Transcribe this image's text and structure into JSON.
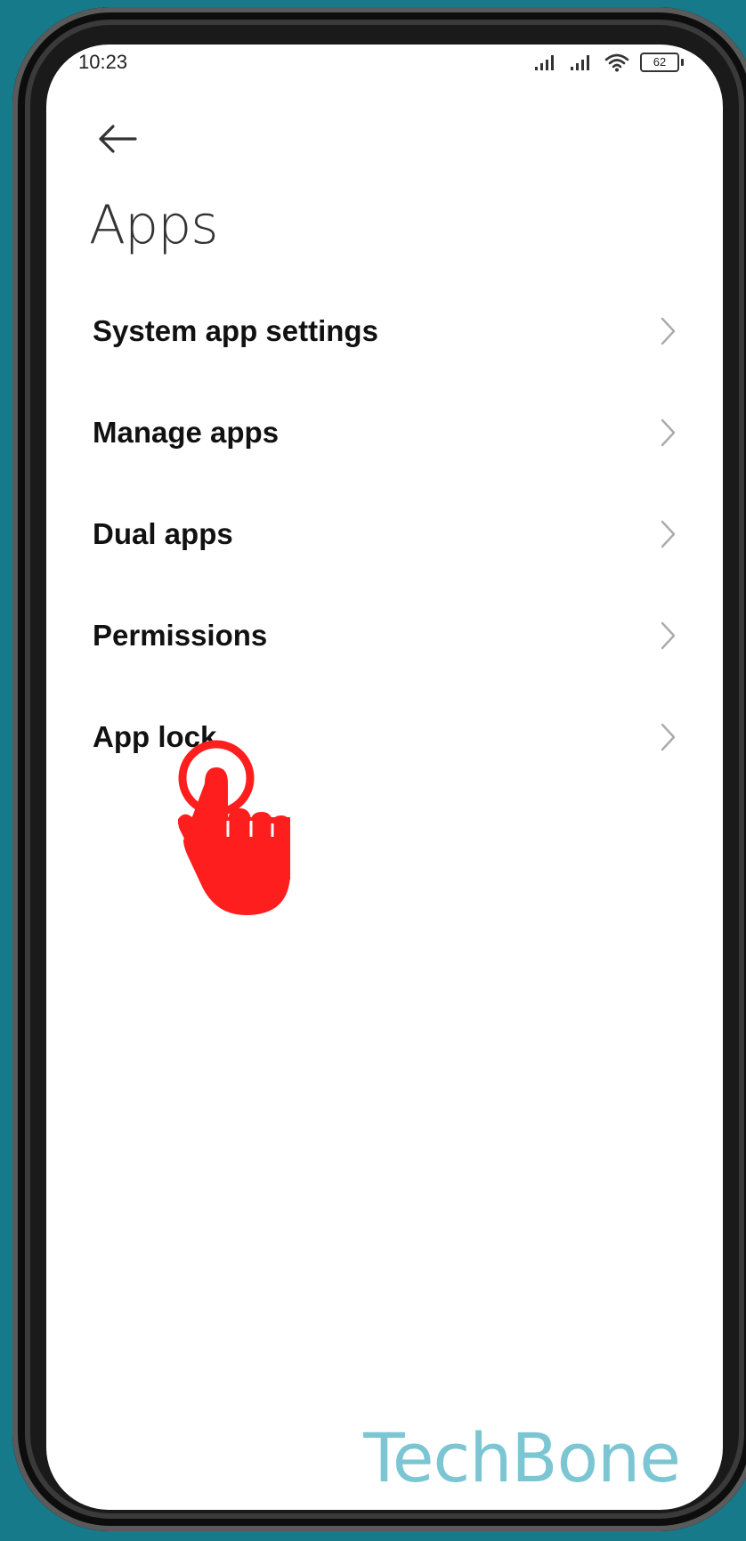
{
  "status_bar": {
    "time": "10:23",
    "battery": "62",
    "icons": [
      "signal-icon",
      "signal-icon",
      "wifi-icon",
      "battery-icon"
    ]
  },
  "header": {
    "back_icon": "back-arrow-icon",
    "title": "Apps"
  },
  "menu": {
    "items": [
      {
        "label": "System app settings",
        "icon": "chevron-right-icon"
      },
      {
        "label": "Manage apps",
        "icon": "chevron-right-icon"
      },
      {
        "label": "Dual apps",
        "icon": "chevron-right-icon"
      },
      {
        "label": "Permissions",
        "icon": "chevron-right-icon"
      },
      {
        "label": "App lock",
        "icon": "chevron-right-icon"
      }
    ]
  },
  "overlay": {
    "tap_indicator": "tap-hand-icon",
    "watermark": "TechBone"
  },
  "colors": {
    "background": "#167a8a",
    "tap_indicator": "#ff1e1e",
    "watermark": "#7cc6d4"
  }
}
